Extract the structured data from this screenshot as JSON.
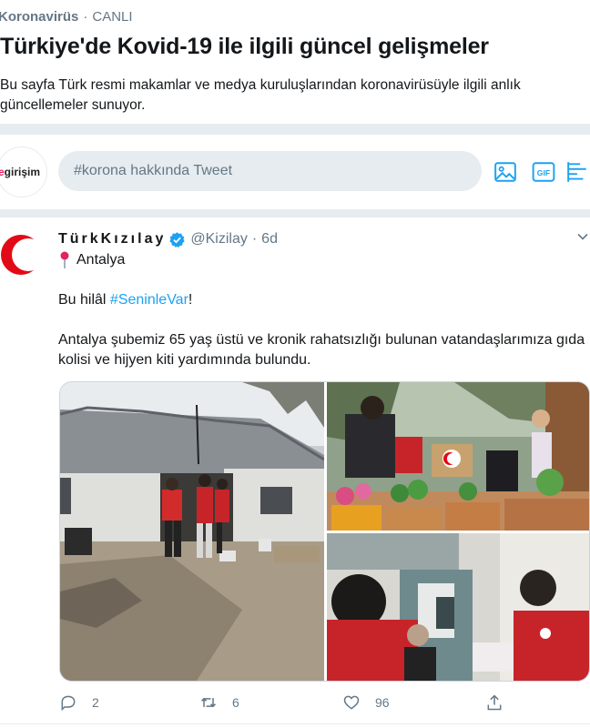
{
  "header": {
    "topic": "Koronavirüs",
    "live": "CANLI",
    "title": "Türkiye'de Kovid-19 ile ilgili güncel gelişmeler",
    "description": "Bu sayfa Türk resmi makamlar ve medya kuruluşlarından koronavirüsüyle ilgili anlık güncellemeler sunuyor."
  },
  "compose": {
    "avatar_text_prefix": "e",
    "avatar_text": "girişim",
    "placeholder": "#korona hakkında Tweet",
    "icons": [
      "image-icon",
      "gif-icon",
      "poll-icon"
    ]
  },
  "tweet": {
    "author_name": "TürkKızılay",
    "handle": "@Kizilay",
    "separator": "·",
    "time": "6d",
    "location": "Antalya",
    "text_prefix": "Bu hilâl ",
    "hashtag": "#SeninleVar",
    "text_suffix": "!",
    "body": "Antalya şubemiz 65 yaş üstü ve kronik rahatsızlığı bulunan vatandaşlarımıza gıda kolisi ve hijyen kiti yardımında bulundu.",
    "replies": "2",
    "retweets": "6",
    "likes": "96"
  },
  "colors": {
    "accent": "#1da1f2",
    "muted": "#657786",
    "divider": "#e6ecf0",
    "brand_red": "#e30a17"
  }
}
